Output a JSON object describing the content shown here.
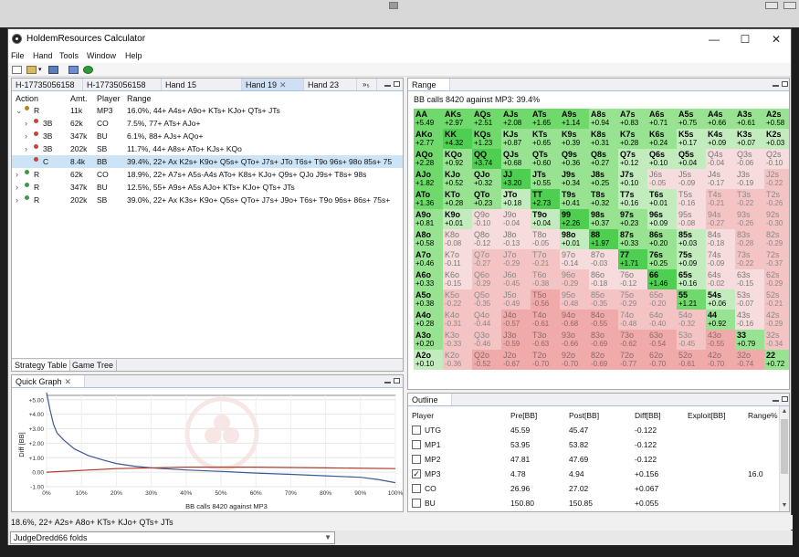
{
  "window": {
    "title": "HoldemResources Calculator"
  },
  "menu": [
    "File",
    "Hand",
    "Tools",
    "Window",
    "Help"
  ],
  "hand_tabs": [
    "H-17735056158",
    "H-17735056158",
    "Hand 15",
    "Hand 19",
    "Hand 23"
  ],
  "hand_tab_overflow": "»₅",
  "strategy": {
    "headers": {
      "action": "Action",
      "amt": "Amt.",
      "player": "Player",
      "range": "Range"
    },
    "rows": [
      {
        "expander": "⌄",
        "action": "R",
        "amt": "11k",
        "player": "MP3",
        "range": "16.0%, 44+ A4s+ A9o+ KTs+ KJo+ QTs+ JTs",
        "indent": 0,
        "dot": "#b5841f",
        "selected": false
      },
      {
        "expander": "›",
        "action": "3B",
        "amt": "62k",
        "player": "CO",
        "range": "7.5%, 77+ ATs+ AJo+",
        "indent": 1,
        "dot": "#c8423b",
        "selected": false
      },
      {
        "expander": "›",
        "action": "3B",
        "amt": "347k",
        "player": "BU",
        "range": "6.1%, 88+ AJs+ AQo+",
        "indent": 1,
        "dot": "#c8423b",
        "selected": false
      },
      {
        "expander": "›",
        "action": "3B",
        "amt": "202k",
        "player": "SB",
        "range": "11.7%, 44+ A8s+ ATo+ KJs+ KQo",
        "indent": 1,
        "dot": "#c8423b",
        "selected": false
      },
      {
        "expander": "",
        "action": "C",
        "amt": "8.4k",
        "player": "BB",
        "range": "39.4%, 22+ Ax K2s+ K9o+ Q5s+ QTo+ J7s+ JTo T6s+ T9o 96s+ 98o 85s+ 75",
        "indent": 1,
        "dot": "#c8423b",
        "selected": true
      },
      {
        "expander": "›",
        "action": "R",
        "amt": "62k",
        "player": "CO",
        "range": "18.9%, 22+ A7s+ A5s-A4s ATo+ K8s+ KJo+ Q9s+ QJo J9s+ T8s+ 98s",
        "indent": 0,
        "dot": "#3a9a4a",
        "selected": false
      },
      {
        "expander": "›",
        "action": "R",
        "amt": "347k",
        "player": "BU",
        "range": "12.5%, 55+ A9s+ A5s AJo+ KTs+ KJo+ QTs+ JTs",
        "indent": 0,
        "dot": "#3a9a4a",
        "selected": false
      },
      {
        "expander": "›",
        "action": "R",
        "amt": "202k",
        "player": "SB",
        "range": "39.0%, 22+ Ax K3s+ K9o+ Q5s+ QTo+ J7s+ J9o+ T6s+ T9o 96s+ 86s+ 75s+",
        "indent": 0,
        "dot": "#3a9a4a",
        "selected": false
      }
    ],
    "bottom_tabs": [
      "Strategy Table",
      "Game Tree"
    ]
  },
  "range": {
    "tab_label": "Range",
    "subtitle": "BB calls 8420 against MP3: 39.4%",
    "grid": [
      [
        [
          "AA",
          "+5.49"
        ],
        [
          "AKs",
          "+2.97"
        ],
        [
          "AQs",
          "+2.51"
        ],
        [
          "AJs",
          "+2.08"
        ],
        [
          "ATs",
          "+1.65"
        ],
        [
          "A9s",
          "+1.14"
        ],
        [
          "A8s",
          "+0.94"
        ],
        [
          "A7s",
          "+0.83"
        ],
        [
          "A6s",
          "+0.71"
        ],
        [
          "A5s",
          "+0.75"
        ],
        [
          "A4s",
          "+0.66"
        ],
        [
          "A3s",
          "+0.61"
        ],
        [
          "A2s",
          "+0.58"
        ]
      ],
      [
        [
          "AKo",
          "+2.77"
        ],
        [
          "KK",
          "+4.32"
        ],
        [
          "KQs",
          "+1.23"
        ],
        [
          "KJs",
          "+0.87"
        ],
        [
          "KTs",
          "+0.65"
        ],
        [
          "K9s",
          "+0.39"
        ],
        [
          "K8s",
          "+0.31"
        ],
        [
          "K7s",
          "+0.28"
        ],
        [
          "K6s",
          "+0.24"
        ],
        [
          "K5s",
          "+0.17"
        ],
        [
          "K4s",
          "+0.09"
        ],
        [
          "K3s",
          "+0.07"
        ],
        [
          "K2s",
          "+0.03"
        ]
      ],
      [
        [
          "AQo",
          "+2.28"
        ],
        [
          "KQo",
          "+0.92"
        ],
        [
          "QQ",
          "+3.74"
        ],
        [
          "QJs",
          "+0.68"
        ],
        [
          "QTs",
          "+0.60"
        ],
        [
          "Q9s",
          "+0.36"
        ],
        [
          "Q8s",
          "+0.27"
        ],
        [
          "Q7s",
          "+0.12"
        ],
        [
          "Q6s",
          "+0.10"
        ],
        [
          "Q5s",
          "+0.04"
        ],
        [
          "Q4s",
          "-0.04"
        ],
        [
          "Q3s",
          "-0.06"
        ],
        [
          "Q2s",
          "-0.10"
        ]
      ],
      [
        [
          "AJo",
          "+1.82"
        ],
        [
          "KJo",
          "+0.52"
        ],
        [
          "QJo",
          "+0.32"
        ],
        [
          "JJ",
          "+3.20"
        ],
        [
          "JTs",
          "+0.55"
        ],
        [
          "J9s",
          "+0.34"
        ],
        [
          "J8s",
          "+0.25"
        ],
        [
          "J7s",
          "+0.10"
        ],
        [
          "J6s",
          "-0.05"
        ],
        [
          "J5s",
          "-0.09"
        ],
        [
          "J4s",
          "-0.17"
        ],
        [
          "J3s",
          "-0.19"
        ],
        [
          "J2s",
          "-0.22"
        ]
      ],
      [
        [
          "ATo",
          "+1.36"
        ],
        [
          "KTo",
          "+0.28"
        ],
        [
          "QTo",
          "+0.23"
        ],
        [
          "JTo",
          "+0.18"
        ],
        [
          "TT",
          "+2.73"
        ],
        [
          "T9s",
          "+0.41"
        ],
        [
          "T8s",
          "+0.32"
        ],
        [
          "T7s",
          "+0.16"
        ],
        [
          "T6s",
          "+0.01"
        ],
        [
          "T5s",
          "-0.16"
        ],
        [
          "T4s",
          "-0.21"
        ],
        [
          "T3s",
          "-0.22"
        ],
        [
          "T2s",
          "-0.26"
        ]
      ],
      [
        [
          "A9o",
          "+0.81"
        ],
        [
          "K9o",
          "+0.01"
        ],
        [
          "Q9o",
          "-0.10"
        ],
        [
          "J9o",
          "-0.04"
        ],
        [
          "T9o",
          "+0.04"
        ],
        [
          "99",
          "+2.26"
        ],
        [
          "98s",
          "+0.37"
        ],
        [
          "97s",
          "+0.23"
        ],
        [
          "96s",
          "+0.09"
        ],
        [
          "95s",
          "-0.08"
        ],
        [
          "94s",
          "-0.27"
        ],
        [
          "93s",
          "-0.26"
        ],
        [
          "92s",
          "-0.30"
        ]
      ],
      [
        [
          "A8o",
          "+0.58"
        ],
        [
          "K8o",
          "-0.08"
        ],
        [
          "Q8o",
          "-0.12"
        ],
        [
          "J8o",
          "-0.13"
        ],
        [
          "T8o",
          "-0.05"
        ],
        [
          "98o",
          "+0.01"
        ],
        [
          "88",
          "+1.97"
        ],
        [
          "87s",
          "+0.33"
        ],
        [
          "86s",
          "+0.20"
        ],
        [
          "85s",
          "+0.03"
        ],
        [
          "84s",
          "-0.18"
        ],
        [
          "83s",
          "-0.28"
        ],
        [
          "82s",
          "-0.29"
        ]
      ],
      [
        [
          "A7o",
          "+0.46"
        ],
        [
          "K7o",
          "-0.11"
        ],
        [
          "Q7o",
          "-0.27"
        ],
        [
          "J7o",
          "-0.29"
        ],
        [
          "T7o",
          "-0.21"
        ],
        [
          "97o",
          "-0.14"
        ],
        [
          "87o",
          "-0.03"
        ],
        [
          "77",
          "+1.71"
        ],
        [
          "76s",
          "+0.25"
        ],
        [
          "75s",
          "+0.09"
        ],
        [
          "74s",
          "-0.09"
        ],
        [
          "73s",
          "-0.22"
        ],
        [
          "72s",
          "-0.37"
        ]
      ],
      [
        [
          "A6o",
          "+0.33"
        ],
        [
          "K6o",
          "-0.15"
        ],
        [
          "Q6o",
          "-0.29"
        ],
        [
          "J6o",
          "-0.45"
        ],
        [
          "T6o",
          "-0.38"
        ],
        [
          "96o",
          "-0.29"
        ],
        [
          "86o",
          "-0.18"
        ],
        [
          "76o",
          "-0.12"
        ],
        [
          "66",
          "+1.46"
        ],
        [
          "65s",
          "+0.16"
        ],
        [
          "64s",
          "-0.02"
        ],
        [
          "63s",
          "-0.15"
        ],
        [
          "62s",
          "-0.29"
        ]
      ],
      [
        [
          "A5o",
          "+0.38"
        ],
        [
          "K5o",
          "-0.22"
        ],
        [
          "Q5o",
          "-0.35"
        ],
        [
          "J5o",
          "-0.49"
        ],
        [
          "T5o",
          "-0.56"
        ],
        [
          "95o",
          "-0.48"
        ],
        [
          "85o",
          "-0.35"
        ],
        [
          "75o",
          "-0.29"
        ],
        [
          "65o",
          "-0.20"
        ],
        [
          "55",
          "+1.21"
        ],
        [
          "54s",
          "+0.06"
        ],
        [
          "53s",
          "-0.07"
        ],
        [
          "52s",
          "-0.21"
        ]
      ],
      [
        [
          "A4o",
          "+0.28"
        ],
        [
          "K4o",
          "-0.31"
        ],
        [
          "Q4o",
          "-0.44"
        ],
        [
          "J4o",
          "-0.57"
        ],
        [
          "T4o",
          "-0.61"
        ],
        [
          "94o",
          "-0.68"
        ],
        [
          "84o",
          "-0.55"
        ],
        [
          "74o",
          "-0.48"
        ],
        [
          "64o",
          "-0.40"
        ],
        [
          "54o",
          "-0.32"
        ],
        [
          "44",
          "+0.92"
        ],
        [
          "43s",
          "-0.16"
        ],
        [
          "42s",
          "-0.29"
        ]
      ],
      [
        [
          "A3o",
          "+0.20"
        ],
        [
          "K3o",
          "-0.33"
        ],
        [
          "Q3o",
          "-0.46"
        ],
        [
          "J3o",
          "-0.59"
        ],
        [
          "T3o",
          "-0.63"
        ],
        [
          "93o",
          "-0.66"
        ],
        [
          "83o",
          "-0.69"
        ],
        [
          "73o",
          "-0.62"
        ],
        [
          "63o",
          "-0.54"
        ],
        [
          "53o",
          "-0.45"
        ],
        [
          "43o",
          "-0.55"
        ],
        [
          "33",
          "+0.79"
        ],
        [
          "32s",
          "-0.34"
        ]
      ],
      [
        [
          "A2o",
          "+0.10"
        ],
        [
          "K2o",
          "-0.36"
        ],
        [
          "Q2o",
          "-0.52"
        ],
        [
          "J2o",
          "-0.67"
        ],
        [
          "T2o",
          "-0.70"
        ],
        [
          "92o",
          "-0.70"
        ],
        [
          "82o",
          "-0.69"
        ],
        [
          "72o",
          "-0.77"
        ],
        [
          "62o",
          "-0.70"
        ],
        [
          "52o",
          "-0.61"
        ],
        [
          "42o",
          "-0.70"
        ],
        [
          "32o",
          "-0.74"
        ],
        [
          "22",
          "+0.72"
        ]
      ]
    ]
  },
  "quick_graph": {
    "tab_label": "Quick Graph",
    "chart_data": {
      "type": "line",
      "title": "",
      "xlabel": "BB calls 8420 against MP3",
      "ylabel": "Diff [BB]",
      "x_ticks": [
        "0%",
        "10%",
        "20%",
        "30%",
        "40%",
        "50%",
        "60%",
        "70%",
        "80%",
        "90%",
        "100%"
      ],
      "y_ticks": [
        "+5.00",
        "+4.00",
        "+3.00",
        "+2.00",
        "+1.00",
        "0.00",
        "-1.00"
      ],
      "xlim": [
        0,
        100
      ],
      "ylim": [
        -1.0,
        5.3
      ],
      "series": [
        {
          "color": "#3b5a98",
          "x": [
            0,
            1,
            2,
            3,
            5,
            8,
            12,
            16,
            20,
            25,
            30,
            40,
            50,
            60,
            70,
            80,
            90,
            95,
            100
          ],
          "y": [
            5.49,
            4.3,
            3.3,
            2.7,
            2.2,
            1.6,
            1.15,
            0.85,
            0.6,
            0.42,
            0.3,
            0.15,
            0.05,
            -0.06,
            -0.15,
            -0.25,
            -0.35,
            -0.5,
            -0.72
          ]
        },
        {
          "color": "#b03a2e",
          "x": [
            0,
            20,
            40,
            60,
            80,
            100
          ],
          "y": [
            0.0,
            0.25,
            0.35,
            0.35,
            0.3,
            0.25
          ]
        }
      ]
    }
  },
  "outline": {
    "tab_label": "Outline",
    "headers": [
      "Player",
      "Pre[BB]",
      "Post[BB]",
      "Diff[BB]",
      "Exploit[BB]",
      "Range%"
    ],
    "rows": [
      {
        "checkbox": true,
        "checked": false,
        "player": "UTG",
        "pre": "45.59",
        "post": "45.47",
        "diff": "-0.122",
        "exploit": "",
        "range": ""
      },
      {
        "checkbox": true,
        "checked": false,
        "player": "MP1",
        "pre": "53.95",
        "post": "53.82",
        "diff": "-0.122",
        "exploit": "",
        "range": ""
      },
      {
        "checkbox": true,
        "checked": false,
        "player": "MP2",
        "pre": "47.81",
        "post": "47.69",
        "diff": "-0.122",
        "exploit": "",
        "range": ""
      },
      {
        "checkbox": true,
        "checked": true,
        "player": "MP3",
        "pre": "4.78",
        "post": "4.94",
        "diff": "+0.156",
        "exploit": "",
        "range": "16.0"
      },
      {
        "checkbox": true,
        "checked": false,
        "player": "CO",
        "pre": "26.96",
        "post": "27.02",
        "diff": "+0.067",
        "exploit": "",
        "range": ""
      },
      {
        "checkbox": true,
        "checked": false,
        "player": "BU",
        "pre": "150.80",
        "post": "150.85",
        "diff": "+0.055",
        "exploit": "",
        "range": ""
      }
    ]
  },
  "status": {
    "text": "18.6%, 22+ A2s+ A8o+ KTs+ KJo+ QTs+ JTs"
  },
  "bottom": {
    "combo_text": "JudgeDredd66 folds"
  }
}
